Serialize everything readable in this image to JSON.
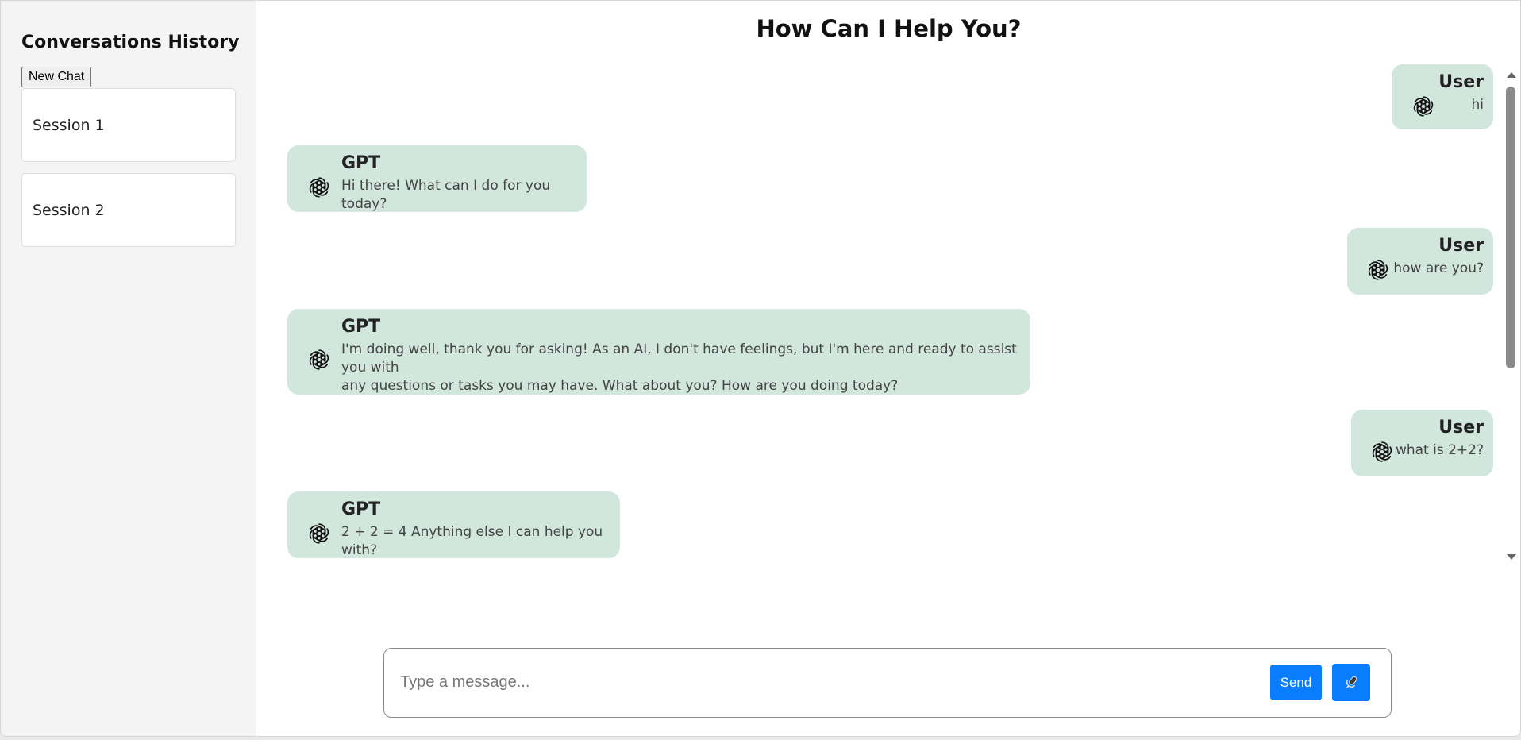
{
  "sidebar": {
    "title": "Conversations History",
    "new_chat_label": "New Chat",
    "sessions": [
      {
        "label": "Session 1"
      },
      {
        "label": "Session 2"
      }
    ]
  },
  "main": {
    "title": "How Can I Help You?"
  },
  "messages": [
    {
      "role": "user",
      "sender": "User",
      "text": "hi",
      "avatar_icon": "openai-logo-icon"
    },
    {
      "role": "assistant",
      "sender": "GPT",
      "text": "Hi there! What can I do for you today?",
      "avatar_icon": "openai-logo-icon"
    },
    {
      "role": "user",
      "sender": "User",
      "text": "how are you?",
      "avatar_icon": "openai-logo-icon"
    },
    {
      "role": "assistant",
      "sender": "GPT",
      "text_lines": [
        "I'm doing well, thank you for asking! As an AI, I don't have feelings, but I'm here and ready to assist you with",
        "any questions or tasks you may have. What about you? How are you doing today?"
      ],
      "avatar_icon": "openai-logo-icon"
    },
    {
      "role": "user",
      "sender": "User",
      "text": "what is 2+2?",
      "avatar_icon": "openai-logo-icon"
    },
    {
      "role": "assistant",
      "sender": "GPT",
      "text": "2 + 2 = 4 Anything else I can help you with?",
      "avatar_icon": "openai-logo-icon"
    }
  ],
  "composer": {
    "placeholder": "Type a message...",
    "value": "",
    "send_label": "Send",
    "mic_icon": "microphone-icon"
  },
  "colors": {
    "bubble": "#d1e6dc",
    "accent": "#0a7cff",
    "sidebar_bg": "#f4f4f4"
  }
}
